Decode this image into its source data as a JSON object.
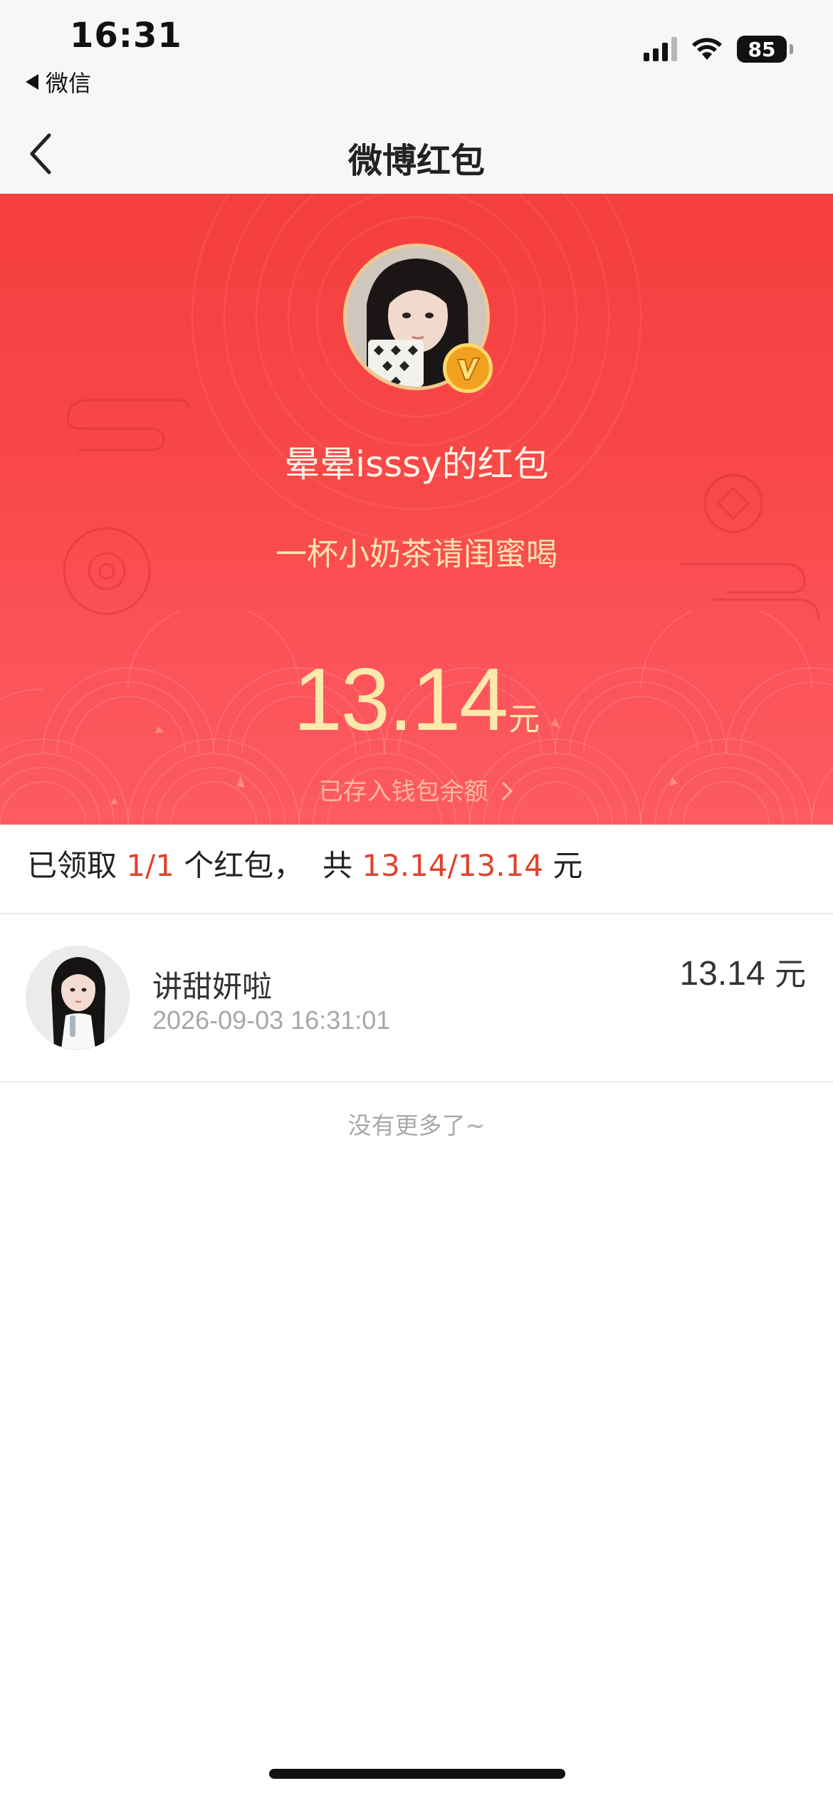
{
  "status_bar": {
    "time": "16:31",
    "back_app": "微信",
    "battery": "85"
  },
  "nav": {
    "title": "微博红包",
    "back_icon": "chevron-left-icon"
  },
  "envelope": {
    "sender_name": "晕晕isssy的红包",
    "greeting": "一杯小奶茶请闺蜜喝",
    "amount": "13.14",
    "unit": "元",
    "wallet_link": "已存入钱包余额",
    "badge_icon": "verified-v-icon"
  },
  "summary": {
    "prefix": "已领取 ",
    "count": "1/1",
    "middle": " 个红包，  共 ",
    "total": "13.14/13.14",
    "suffix": " 元"
  },
  "receivers": [
    {
      "name": "讲甜妍啦",
      "time": "2026-09-03 16:31:01",
      "amount": "13.14",
      "unit": "元"
    }
  ],
  "footer_text": "没有更多了~",
  "colors": {
    "envelope_red": "#f53e3e",
    "highlight": "#e0422e",
    "amount_gold": "#fde9a9"
  }
}
